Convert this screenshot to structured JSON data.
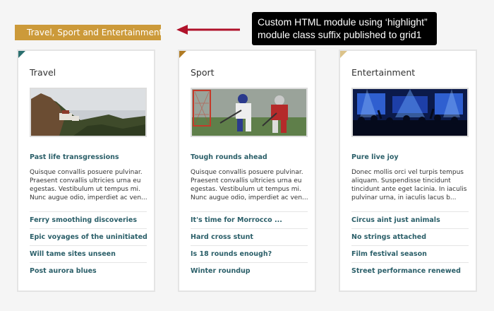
{
  "module_title": "Travel, Sport and Entertainment",
  "annotation": {
    "line1": "Custom HTML module using ‘highlight”",
    "line2": "module class suffix published to grid1"
  },
  "colors": {
    "highlight": "#cc9a3a",
    "arrow": "#b0122a",
    "link": "#2b5f69",
    "corner_travel": "#2b6f6f",
    "corner_sport": "#b07b24",
    "corner_entertainment": "#dcc38a"
  },
  "cards": [
    {
      "heading": "Travel",
      "image_icon": "mountain-monastery-photo",
      "lead_title": "Past life transgressions",
      "lead_body": "Quisque convallis posuere pulvinar. Praesent convallis ultricies urna eu egestas. Vestibulum ut tempus mi. Nunc augue odio, imperdiet ac ven...",
      "links": [
        "Ferry smoothing discoveries",
        "Epic voyages of the uninitiated",
        "Will tame sites unseen",
        "Post aurora blues"
      ]
    },
    {
      "heading": "Sport",
      "image_icon": "lacrosse-players-photo",
      "lead_title": "Tough rounds ahead",
      "lead_body": "Quisque convallis posuere pulvinar. Praesent convallis ultricies urna eu egestas. Vestibulum ut tempus mi. Nunc augue odio, imperdiet ac ven...",
      "links": [
        "It's time for Morrocco ...",
        "Hard cross stunt",
        "Is 18 rounds enough?",
        "Winter roundup"
      ]
    },
    {
      "heading": "Entertainment",
      "image_icon": "concert-stage-photo",
      "lead_title": "Pure live joy",
      "lead_body": "Donec mollis orci vel turpis tempus aliquam. Suspendisse tincidunt tincidunt ante eget lacinia. In iaculis pulvinar urna, in iaculis lacus b...",
      "links": [
        "Circus aint just animals",
        "No strings attached",
        "Film festival season",
        "Street performance renewed"
      ]
    }
  ]
}
